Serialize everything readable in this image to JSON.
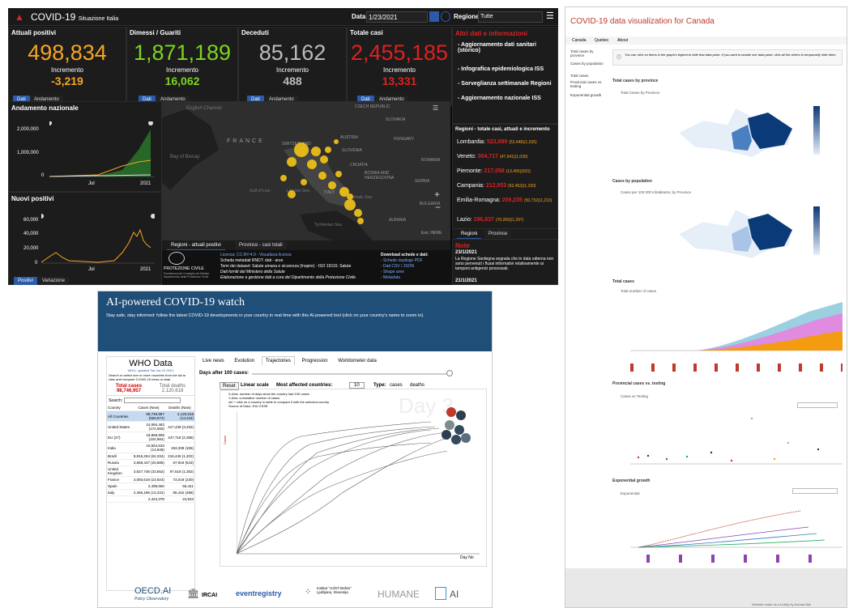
{
  "italy": {
    "title": "COVID-19",
    "subtitle": "Situazione Italia",
    "date_label": "Data",
    "date_value": "1/23/2021",
    "region_label": "Regione",
    "region_value": "Tutte",
    "stats": [
      {
        "header": "Attuali positivi",
        "value": "498,834",
        "inc_label": "Incremento",
        "inc": "-3,219",
        "color": "#f5a623",
        "tabs": [
          "Dati",
          "Andamento"
        ]
      },
      {
        "header": "Dimessi / Guariti",
        "value": "1,871,189",
        "inc_label": "Incremento",
        "inc": "16,062",
        "color": "#7ed321",
        "tabs": [
          "Dati",
          "Andamento"
        ]
      },
      {
        "header": "Deceduti",
        "value": "85,162",
        "inc_label": "Incremento",
        "inc": "488",
        "color": "#bbbbbb",
        "tabs": [
          "Dati",
          "Andamento"
        ]
      },
      {
        "header": "Totale casi",
        "value": "2,455,185",
        "inc_label": "Incremento",
        "inc": "13,331",
        "color": "#e02020",
        "tabs": [
          "Dati",
          "Andamento"
        ]
      }
    ],
    "links_header": "Altri dati e informazioni",
    "links": [
      "- Aggiornamento dati sanitari (storico)",
      "- Infografica epidemiologica ISS",
      "- Sorveglianza settimanale Regioni",
      "- Aggiornamento nazionale ISS"
    ],
    "trend_title": "Andamento nazionale",
    "trend_yticks": [
      "2,000,000",
      "1,000,000",
      "0"
    ],
    "trend_xticks": [
      "Jul",
      "2021"
    ],
    "newpos_title": "Nuovi positivi",
    "newpos_yticks": [
      "60,000",
      "40,000",
      "20,000",
      "0"
    ],
    "newpos_xticks": [
      "Jul",
      "2021"
    ],
    "newpos_tabs": [
      "Positivi",
      "Variazione"
    ],
    "map_labels": [
      "English Channel",
      "Bay of Biscay",
      "FRANCE",
      "SWITZERLAND",
      "AUSTRIA",
      "CZECH REPUBLIC",
      "SLOVAKIA",
      "HUNGARY",
      "SLOVENIA",
      "CROATIA",
      "ROMANIA",
      "BOSNIA AND HERZEGOVINA",
      "SERBIA",
      "BULGARIA",
      "ALBANIA",
      "Gulf of Lion",
      "Ligurian Sea",
      "ITALY",
      "Adriatic Sea",
      "Tyrrhenian Sea"
    ],
    "map_tabs": [
      "Regioni - attuali positivi",
      "Province - casi totali"
    ],
    "map_credit": "Esri, HERE",
    "regions_header": "Regioni - totale casi, attuali e incremento",
    "regions": [
      {
        "name": "Lombardia:",
        "total": "523,899",
        "detail": "(52,448)(1,535)"
      },
      {
        "name": "Veneto:",
        "total": "304,717",
        "detail": "(47,541)(1,030)"
      },
      {
        "name": "Piemonte:",
        "total": "217,058",
        "detail": "(13,455)(931)"
      },
      {
        "name": "Campania:",
        "total": "212,953",
        "detail": "(62,453)(1,150)"
      },
      {
        "name": "Emilia-Romagna:",
        "total": "209,235",
        "detail": "(50,732)(1,210)"
      },
      {
        "name": "Lazio:",
        "total": "196,637",
        "detail": "(70,266)(1,297)"
      }
    ],
    "region_tabs": [
      "Regioni",
      "Province"
    ],
    "note_header": "Note",
    "note_date": "23/1/2021",
    "note_text": "La Regione Sardegna segnala che in data odierna non sono pervenuti i flussi informativi relativamente ai tamponi antigenici processati.",
    "note_date2": "21/1/2021",
    "protezione": "PROTEZIONE CIVILE",
    "protezione_sub": "Presidenza del Consiglio dei Ministri Dipartimento della Protezione Civile",
    "license": "Licenza: CC-BY-4.0 - Visualizza licenza",
    "scheda": "Scheda metadati RNDT: dati - aree",
    "temi": "Temi dei dataset: Salute umana e sicurezza (Inspire) - ISO 19115: Salute",
    "fonti": "Dati forniti dal Ministero della Salute",
    "elab": "Elaborazione e gestione dati a cura del Dipartimento della Protezione Civile",
    "download_header": "Download schede e dati:",
    "downloads": [
      "- Schede riepilogo PDF",
      "- Dati CSV / JSON",
      "- Shape aree",
      "- Metadata"
    ]
  },
  "ai": {
    "title": "AI-powered COVID-19 watch",
    "subtitle": "Stay safe, stay informed: follow the latest COVID-19 developments in your country in real time with this AI-powered tool (click on your country's name to zoom in).",
    "who_title": "WHO Data",
    "who_updated": "WHO, updated Sat Jan 23 2021",
    "who_hint": "Search or select one or more countries from the list to view and compare COVID-19 news or data",
    "total_cases_label": "Total cases",
    "total_cases": "98,746,957",
    "total_deaths_label": "Total deaths",
    "total_deaths": "2,120,618",
    "search_label": "Search:",
    "col_country": "Country",
    "col_cases": "Cases (New)",
    "col_deaths": "Deaths (New)",
    "rows": [
      {
        "c": "All Countries",
        "cases": "98,746,957 (569,874)",
        "deaths": "2,120,618 (13,234)"
      },
      {
        "c": "United States",
        "cases": "24,994,463 (172,650)",
        "deaths": "417,439 (3,332)"
      },
      {
        "c": "EU (27)",
        "cases": "18,858,908 (104,984)",
        "deaths": "447,718 (2,385)"
      },
      {
        "c": "India",
        "cases": "10,654,533 (14,849)",
        "deaths": "153,339 (155)"
      },
      {
        "c": "Brazil",
        "cases": "8,816,254 (62,334)",
        "deaths": "216,445 (1,202)"
      },
      {
        "c": "Russia",
        "cases": "3,658,447 (20,585)",
        "deaths": "67,919 (543)"
      },
      {
        "c": "United Kingdom",
        "cases": "3,627,748 (33,652)",
        "deaths": "97,518 (1,352)"
      },
      {
        "c": "France",
        "cases": "3,093,619 (23,924)",
        "deaths": "73,018 (230)"
      },
      {
        "c": "Spain",
        "cases": "2,499,560",
        "deaths": "55,441"
      },
      {
        "c": "Italy",
        "cases": "2,455,185 (13,331)",
        "deaths": "85,162 (488)"
      },
      {
        "c": "",
        "cases": "2,424,378",
        "deaths": "24,933"
      }
    ],
    "tabs": [
      "Live news",
      "Evolution",
      "Trajectories",
      "Progression",
      "Worldometer data"
    ],
    "days_label": "Days after 100 cases:",
    "reset": "Reset",
    "linear_label": "Linear scale",
    "most_label": "Most affected countries:",
    "most_value": "10",
    "type_label": "Type:",
    "type_cases": "cases",
    "type_deaths": "deaths",
    "chart_notes": "X-Axis: number of days since the country had 100 cases\nY-Axis: cumulative number of cases\nctrl + click on a country in table to compare it with the selected country\nSource of Data: JHU CSSE",
    "day_watermark": "Day 3",
    "x_axis_label": "Day No",
    "y_axis_label": "Cases",
    "logos": [
      "OECD.AI",
      "Policy Observatory",
      "IRCAI",
      "eventregistry",
      "Institut \"Jožef Stefan\" Ljubljana, Slovenija",
      "HUMANE",
      "AI"
    ]
  },
  "canada": {
    "title": "COVID-19 data visualization for Canada",
    "nav": [
      "Canada",
      "Quebec",
      "About"
    ],
    "side": [
      "Total cases by province",
      "Cases by population",
      "Total cases",
      "Provincial cases vs. testing",
      "Exponential growth"
    ],
    "info": "You can click on items in the graph's legend to hide that data point. If you want to isolate one data point, click all the others to temporarily hide them.",
    "sec1": "Total cases by province",
    "sec1_sub": "Total Cases by Province",
    "sec2": "Cases by population",
    "sec2_sub": "Cases per 100 000 inhabitants, by Province",
    "sec3": "Total cases",
    "sec3_sub": "Total number of cases",
    "sec4": "Provincial cases vs. testing",
    "sec4_sub": "Cases vs Testing",
    "sec5": "Exponential growth",
    "sec5_sub": "Exponential",
    "footer": "Website made as a hobby by Annaar Bali"
  }
}
